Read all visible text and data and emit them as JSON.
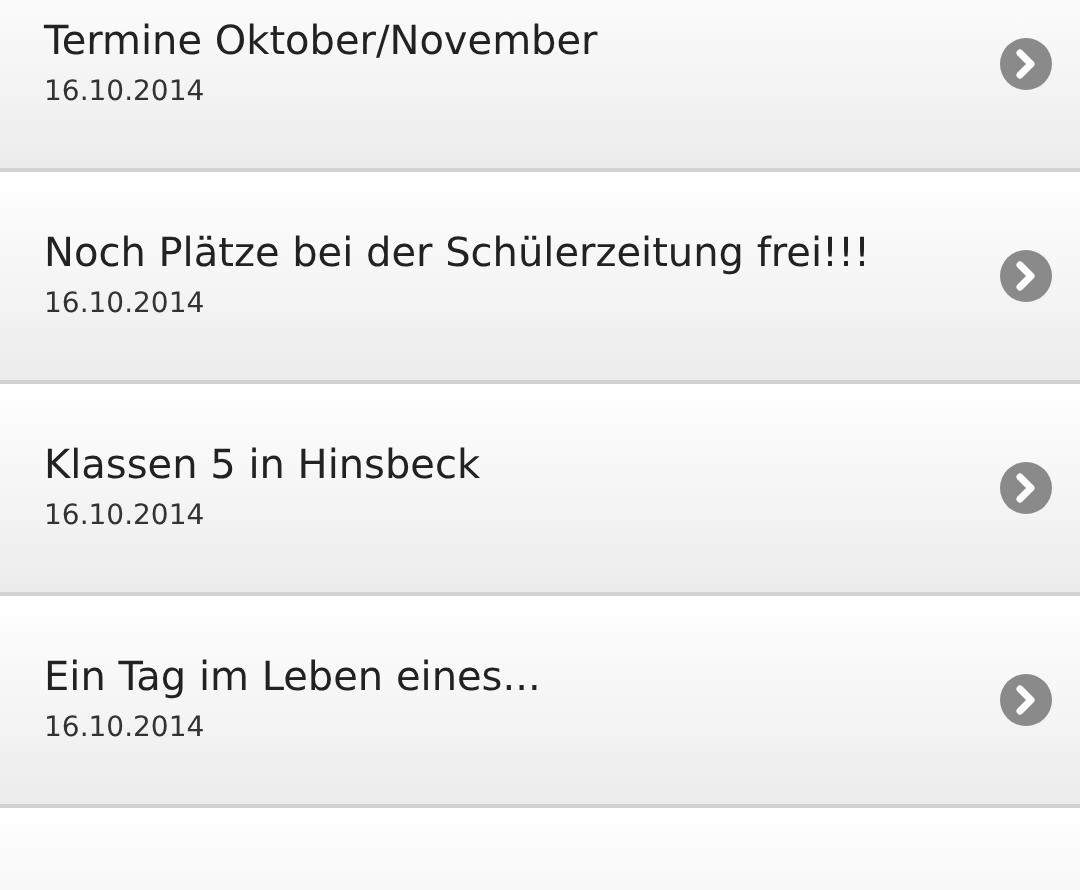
{
  "items": [
    {
      "title": "Termine Oktober/November",
      "date": "16.10.2014"
    },
    {
      "title": "Noch Plätze bei der Schülerzeitung frei!!!",
      "date": "16.10.2014"
    },
    {
      "title": "Klassen 5 in Hinsbeck",
      "date": "16.10.2014"
    },
    {
      "title": "Ein Tag im Leben eines...",
      "date": "16.10.2014"
    }
  ]
}
